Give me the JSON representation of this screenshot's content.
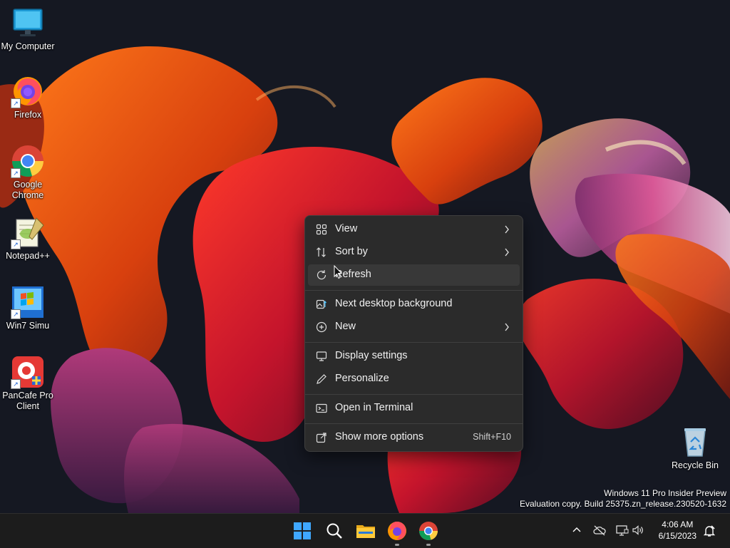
{
  "desktop_icons": [
    {
      "id": "my-computer",
      "label": "My Computer",
      "icon": "monitor-icon"
    },
    {
      "id": "firefox",
      "label": "Firefox",
      "icon": "firefox-icon"
    },
    {
      "id": "chrome",
      "label": "Google Chrome",
      "icon": "chrome-icon"
    },
    {
      "id": "notepadpp",
      "label": "Notepad++",
      "icon": "notepadpp-icon"
    },
    {
      "id": "win7simu",
      "label": "Win7 Simu",
      "icon": "win7-icon"
    },
    {
      "id": "pancafe",
      "label": "PanCafe Pro Client",
      "icon": "pancafe-icon"
    },
    {
      "id": "recycle",
      "label": "Recycle Bin",
      "icon": "recycle-bin-icon"
    }
  ],
  "context_menu": {
    "items": [
      {
        "label": "View",
        "icon": "grid-icon",
        "submenu": true
      },
      {
        "label": "Sort by",
        "icon": "sort-icon",
        "submenu": true
      },
      {
        "label": "Refresh",
        "icon": "refresh-icon",
        "submenu": false
      },
      {
        "label": "Next desktop background",
        "icon": "image-next-icon",
        "submenu": false
      },
      {
        "label": "New",
        "icon": "plus-circle-icon",
        "submenu": true
      },
      {
        "label": "Display settings",
        "icon": "display-icon",
        "submenu": false
      },
      {
        "label": "Personalize",
        "icon": "pen-icon",
        "submenu": false
      },
      {
        "label": "Open in Terminal",
        "icon": "terminal-icon",
        "submenu": false
      },
      {
        "label": "Show more options",
        "icon": "share-icon",
        "submenu": false,
        "shortcut": "Shift+F10"
      }
    ]
  },
  "watermark": {
    "line1": "Windows 11 Pro Insider Preview",
    "line2": "Evaluation copy. Build 25375.zn_release.230520-1632"
  },
  "taskbar": {
    "apps": [
      {
        "name": "start",
        "icon": "windows-logo-icon"
      },
      {
        "name": "search",
        "icon": "search-icon"
      },
      {
        "name": "file-explorer",
        "icon": "folder-icon"
      },
      {
        "name": "firefox",
        "icon": "firefox-icon",
        "running": true
      },
      {
        "name": "chrome",
        "icon": "chrome-icon",
        "running": true
      }
    ],
    "tray": {
      "time": "4:06 AM",
      "date": "6/15/2023"
    }
  },
  "colors": {
    "menu_bg": "#2b2b2b",
    "taskbar_bg": "#1c1c1c",
    "accent": "#4cc2ff"
  }
}
